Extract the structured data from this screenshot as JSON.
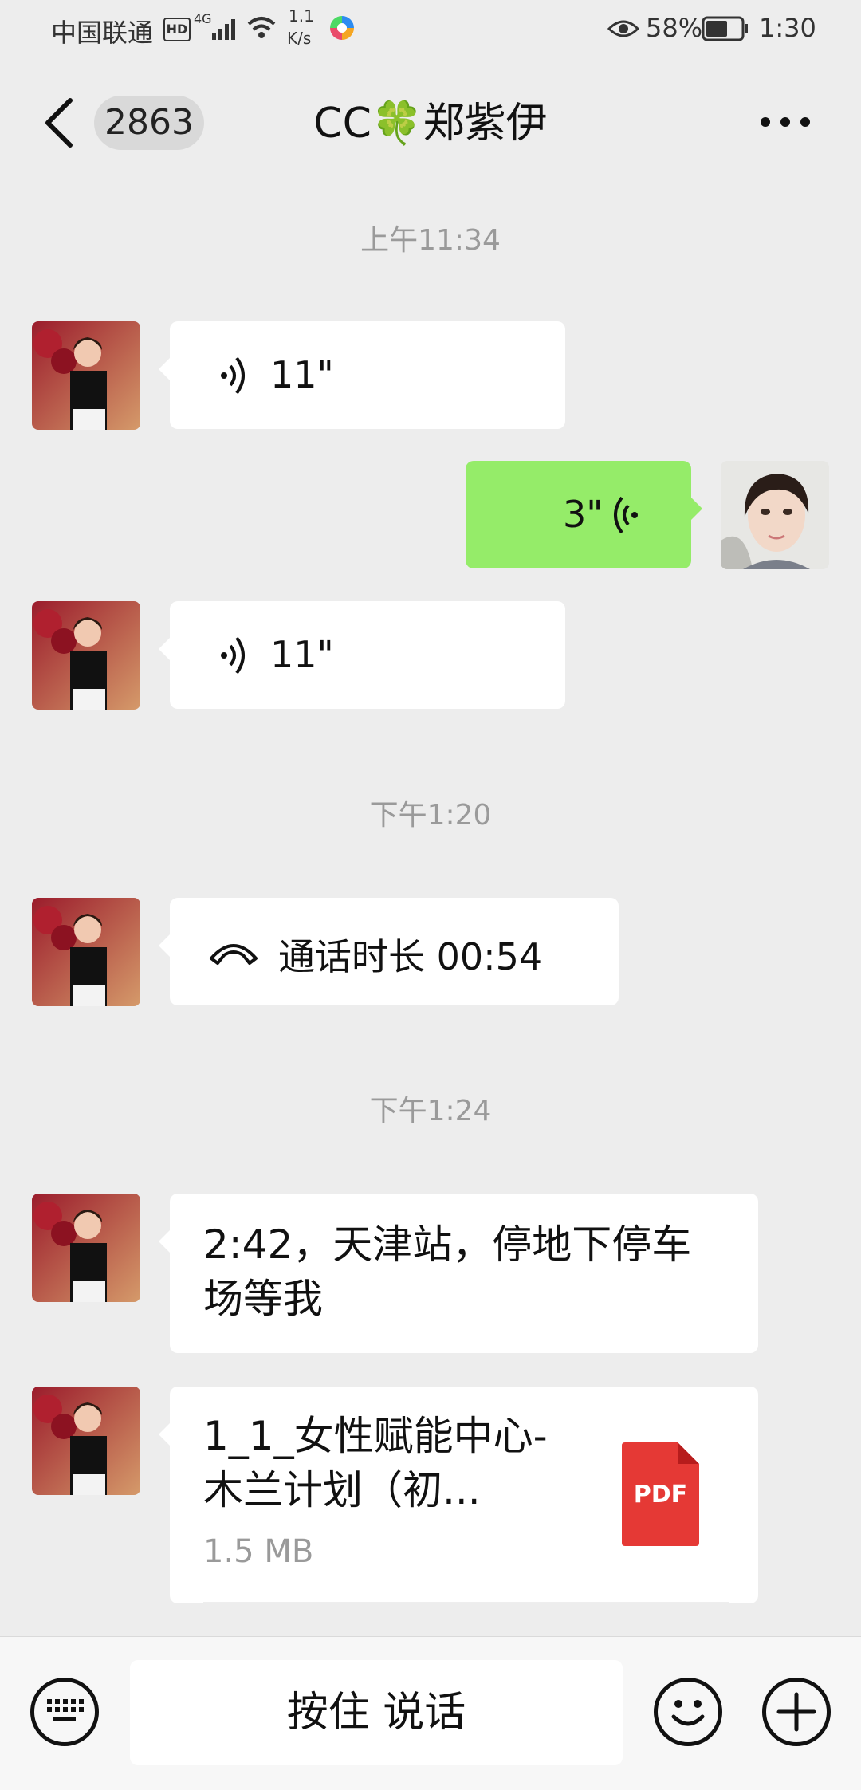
{
  "status_bar": {
    "carrier": "中国联通",
    "hd": "HD",
    "network": "4G",
    "speed_value": "1.1",
    "speed_unit": "K/s",
    "battery": "58%",
    "time": "1:30"
  },
  "header": {
    "unread_count": "2863",
    "title": "CC🍀郑紫伊"
  },
  "messages": [
    {
      "type": "time",
      "text": "上午11:34"
    },
    {
      "type": "voice",
      "direction": "in",
      "duration": "11\""
    },
    {
      "type": "voice",
      "direction": "out",
      "duration": "3\""
    },
    {
      "type": "voice",
      "direction": "in",
      "duration": "11\""
    },
    {
      "type": "time",
      "text": "下午1:20"
    },
    {
      "type": "call",
      "direction": "in",
      "text": "通话时长 00:54"
    },
    {
      "type": "time",
      "text": "下午1:24"
    },
    {
      "type": "text",
      "direction": "in",
      "line1": "2:42，天津站，停地下停车",
      "line2": "场等我"
    },
    {
      "type": "file",
      "direction": "in",
      "name_line1": "1_1_女性赋能中心-",
      "name_line2": "木兰计划（初...",
      "size": "1.5 MB",
      "badge": "PDF"
    }
  ],
  "input_bar": {
    "hold_to_talk": "按住 说话"
  },
  "colors": {
    "background": "#EDEDED",
    "outgoing_bubble": "#95EC69",
    "incoming_bubble": "#FFFFFF",
    "pdf_icon": "#E53935"
  },
  "icons": [
    "back-chevron-icon",
    "more-icon",
    "voice-wave-icon",
    "phone-hangup-icon",
    "pdf-file-icon",
    "keyboard-icon",
    "emoji-icon",
    "plus-icon"
  ]
}
